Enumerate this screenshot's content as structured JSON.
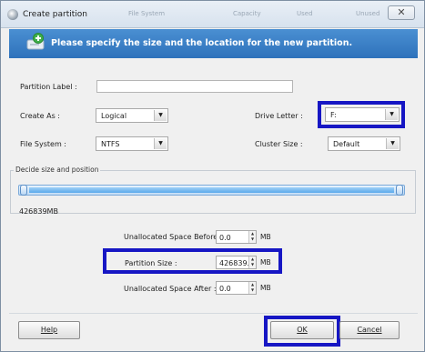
{
  "window": {
    "title": "Create partition",
    "close_glyph": "✕",
    "faint_tabs": [
      "File System",
      "Capacity",
      "Used",
      "Unused"
    ]
  },
  "banner": {
    "text": "Please specify the size and the location for the new partition.",
    "icon": "disk-add-icon"
  },
  "form": {
    "partition_label": {
      "label": "Partition Label :",
      "value": ""
    },
    "create_as": {
      "label": "Create As :",
      "value": "Logical"
    },
    "drive_letter": {
      "label": "Drive Letter :",
      "value": "F:"
    },
    "file_system": {
      "label": "File System :",
      "value": "NTFS"
    },
    "cluster_size": {
      "label": "Cluster Size :",
      "value": "Default"
    }
  },
  "size_position": {
    "title": "Decide size and position",
    "partition_mb": "426839MB",
    "bar_fill_fraction": 1.0
  },
  "space": {
    "before": {
      "label": "Unallocated Space Before :",
      "value": "0.0",
      "unit": "MB"
    },
    "partition_size": {
      "label": "Partition Size :",
      "value": "426839.0",
      "unit": "MB"
    },
    "after": {
      "label": "Unallocated Space After :",
      "value": "0.0",
      "unit": "MB"
    }
  },
  "buttons": {
    "help": "Help",
    "ok": "OK",
    "cancel": "Cancel"
  },
  "colors": {
    "banner": "#3a80c6",
    "highlight": "#1616c4",
    "bar": "#5aa9eb"
  }
}
